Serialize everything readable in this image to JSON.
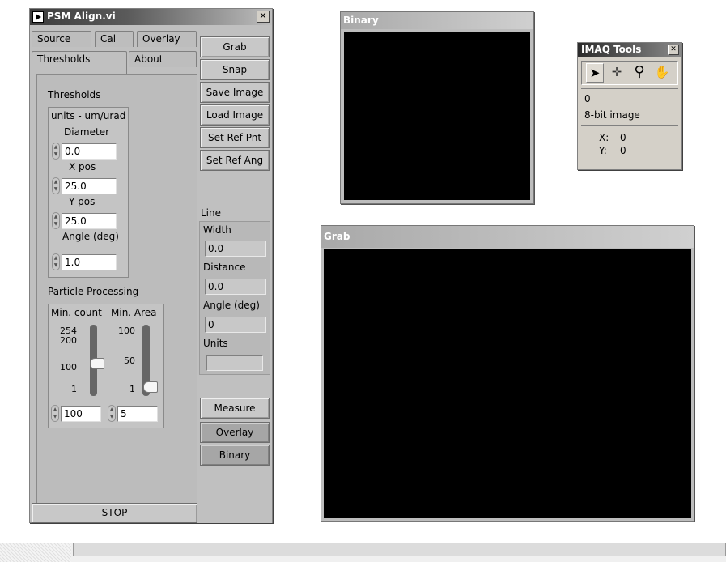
{
  "vi_window": {
    "title": "PSM Align.vi",
    "close_glyph": "✕",
    "tabs_row1": [
      "Source",
      "Cal",
      "Overlay"
    ],
    "tabs_row2": [
      "Thresholds",
      "About"
    ],
    "active_tab": "Thresholds"
  },
  "thresholds": {
    "section_label": "Thresholds",
    "units_label": "units - um/urad",
    "fields": [
      {
        "label": "Diameter",
        "value": "0.0"
      },
      {
        "label": "X pos",
        "value": "25.0"
      },
      {
        "label": "Y pos",
        "value": "25.0"
      },
      {
        "label": "Angle (deg)",
        "value": "1.0"
      }
    ]
  },
  "particle": {
    "section_label": "Particle Processing",
    "min_count": {
      "label": "Min. count",
      "ticks": [
        "254",
        "200",
        "100",
        "1"
      ],
      "value": "100",
      "level": 100,
      "range": [
        1,
        254
      ]
    },
    "min_area": {
      "label": "Min. Area",
      "ticks": [
        "100",
        "50",
        "1"
      ],
      "value": "5",
      "level": 5,
      "range": [
        1,
        100
      ]
    }
  },
  "right_buttons": [
    "Grab",
    "Snap",
    "Save Image",
    "Load Image",
    "Set Ref Pnt",
    "Set Ref Ang"
  ],
  "line": {
    "section_label": "Line",
    "fields": [
      {
        "label": "Width",
        "value": "0.0"
      },
      {
        "label": "Distance",
        "value": "0.0"
      },
      {
        "label": "Angle (deg)",
        "value": "0"
      },
      {
        "label": "Units",
        "value": ""
      }
    ]
  },
  "bottom_buttons": [
    "Measure",
    "Overlay",
    "Binary"
  ],
  "stop_label": "STOP",
  "binary_window": {
    "title": "Binary"
  },
  "grab_window": {
    "title": "Grab"
  },
  "imaq_tools": {
    "title": "IMAQ Tools",
    "close_glyph": "✕",
    "tools": [
      {
        "icon": "arrow-pointer-icon",
        "glyph": "➤"
      },
      {
        "icon": "crosshair-icon",
        "glyph": "✛"
      },
      {
        "icon": "zoom-icon",
        "glyph": "⚲"
      },
      {
        "icon": "pan-hand-icon",
        "glyph": "✋"
      }
    ],
    "value": "0",
    "image_type": "8-bit image",
    "x_label": "X:",
    "x_value": "0",
    "y_label": "Y:",
    "y_value": "0"
  },
  "colors": {
    "panel_gray": "#c0c0c0",
    "canvas_black": "#000000",
    "title_dark": "#3d3d3d"
  }
}
